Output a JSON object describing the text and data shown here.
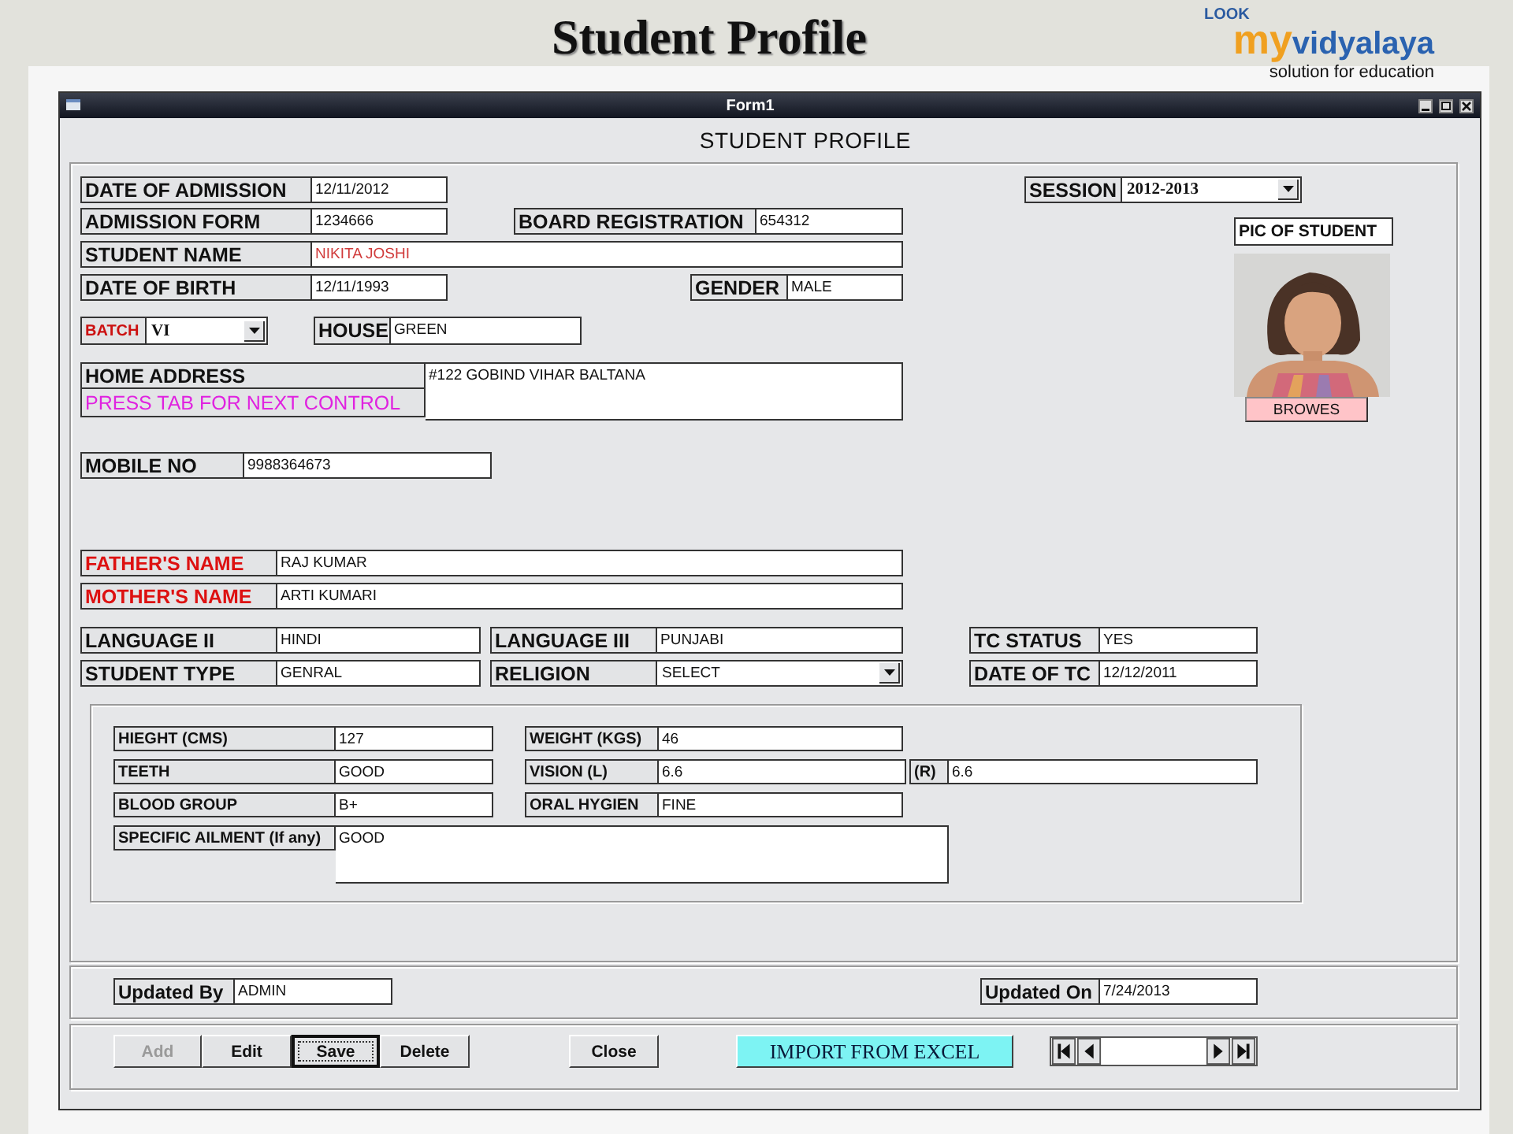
{
  "slide": {
    "title": "Student Profile",
    "logo": {
      "look": "LOOK",
      "my": "my",
      "name": "vidyalaya",
      "tagline": "solution for education"
    }
  },
  "window": {
    "title": "Form1"
  },
  "form": {
    "heading": "STUDENT PROFILE",
    "session": {
      "kind": "combo",
      "label": "SESSION",
      "value": "2012-2013",
      "highlighted": false
    },
    "rows": [
      [
        {
          "kind": "text",
          "label": "DATE OF ADMISSION",
          "value": "12/11/2012",
          "highlighted": false
        }
      ],
      [
        {
          "kind": "text",
          "label": "ADMISSION FORM",
          "value": "1234666",
          "highlighted": false
        },
        {
          "kind": "text",
          "label": "BOARD REGISTRATION",
          "value": "654312",
          "highlighted": false
        }
      ],
      [
        {
          "kind": "text",
          "label": "STUDENT NAME",
          "value": "NIKITA JOSHI",
          "highlighted": true
        }
      ],
      [
        {
          "kind": "text",
          "label": "DATE OF BIRTH",
          "value": "12/11/1993",
          "highlighted": false
        },
        {
          "kind": "text",
          "label": "GENDER",
          "value": "MALE",
          "highlighted": false
        }
      ],
      [
        {
          "kind": "combo",
          "label": "BATCH",
          "value": "VI",
          "color": "#cc1111",
          "highlighted": false
        },
        {
          "kind": "text",
          "label": "HOUSE",
          "value": "GREEN",
          "highlighted": false
        }
      ],
      [
        {
          "kind": "memo",
          "label": "HOME ADDRESS",
          "note": "PRESS TAB FOR NEXT CONTROL",
          "value": "#122 GOBIND VIHAR BALTANA",
          "highlighted": false
        }
      ],
      [
        {
          "kind": "text",
          "label": "MOBILE NO",
          "value": "9988364673",
          "highlighted": false
        }
      ],
      [
        {
          "kind": "text",
          "label": "FATHER'S NAME",
          "value": "RAJ KUMAR",
          "color": "#dd1111",
          "highlighted": false
        }
      ],
      [
        {
          "kind": "text",
          "label": "MOTHER'S NAME",
          "value": "ARTI KUMARI",
          "color": "#dd1111",
          "highlighted": false
        }
      ],
      [
        {
          "kind": "text",
          "label": "LANGUAGE II",
          "value": "HINDI",
          "highlighted": false
        },
        {
          "kind": "text",
          "label": "LANGUAGE III",
          "value": "PUNJABI",
          "highlighted": false
        },
        {
          "kind": "text",
          "label": "TC STATUS",
          "value": "YES",
          "highlighted": false
        }
      ],
      [
        {
          "kind": "text",
          "label": "STUDENT TYPE",
          "value": "GENRAL",
          "highlighted": false
        },
        {
          "kind": "combo",
          "label": "RELIGION",
          "value": "SELECT",
          "highlighted": false
        },
        {
          "kind": "text",
          "label": "DATE OF TC",
          "value": "12/12/2011",
          "highlighted": false
        }
      ]
    ],
    "photo": {
      "label": "PIC OF STUDENT",
      "button": "BROWES"
    },
    "health_rows": [
      [
        {
          "kind": "text",
          "label": "HIEGHT (CMS)",
          "value": "127"
        },
        {
          "kind": "text",
          "label": "WEIGHT (KGS)",
          "value": "46"
        }
      ],
      [
        {
          "kind": "text",
          "label": "TEETH",
          "value": "GOOD"
        },
        {
          "kind": "text",
          "label": "VISION (L)",
          "value": "6.6"
        },
        {
          "kind": "text",
          "label": "(R)",
          "value": "6.6"
        }
      ],
      [
        {
          "kind": "text",
          "label": "BLOOD GROUP",
          "value": "B+"
        },
        {
          "kind": "text",
          "label": "ORAL HYGIEN",
          "value": "FINE"
        }
      ],
      [
        {
          "kind": "memo",
          "label": "SPECIFIC AILMENT (If any)",
          "value": "GOOD"
        }
      ]
    ],
    "updated": [
      {
        "label": "Updated By",
        "value": "ADMIN"
      },
      {
        "label": "Updated On",
        "value": "7/24/2013"
      }
    ],
    "buttons": [
      {
        "label": "Add",
        "disabled": true,
        "focused": false
      },
      {
        "label": "Edit",
        "disabled": false,
        "focused": false
      },
      {
        "label": "Save",
        "disabled": false,
        "focused": true
      },
      {
        "label": "Delete",
        "disabled": false,
        "focused": false
      },
      {
        "label": "Close",
        "disabled": false,
        "focused": false
      }
    ],
    "import_button": "IMPORT FROM EXCEL"
  }
}
